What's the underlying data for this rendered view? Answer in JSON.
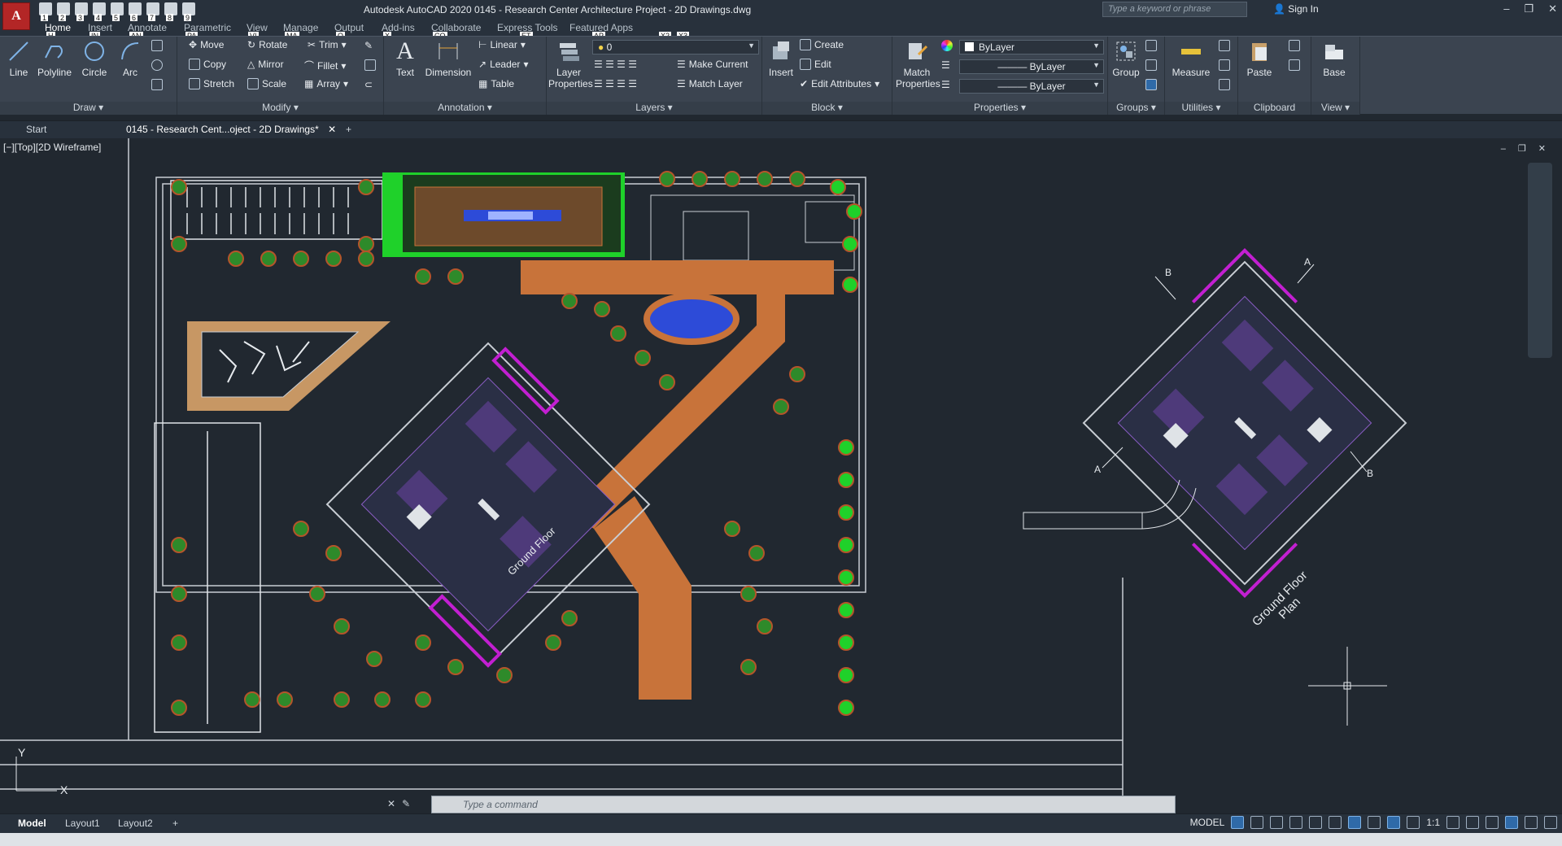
{
  "app": {
    "logo": "A",
    "title": "Autodesk AutoCAD 2020    0145 - Research Center  Architecture Project - 2D Drawings.dwg"
  },
  "search": {
    "placeholder": "Type a keyword or phrase"
  },
  "account": {
    "signin": "Sign In"
  },
  "qat_keytips": [
    "1",
    "2",
    "3",
    "4",
    "5",
    "6",
    "7",
    "8",
    "9"
  ],
  "ribbon_tabs": [
    {
      "label": "Home",
      "key": "H"
    },
    {
      "label": "Insert",
      "key": "IN"
    },
    {
      "label": "Annotate",
      "key": "AN"
    },
    {
      "label": "Parametric",
      "key": "PA"
    },
    {
      "label": "View",
      "key": "VI"
    },
    {
      "label": "Manage",
      "key": "MA"
    },
    {
      "label": "Output",
      "key": "O"
    },
    {
      "label": "Add-ins",
      "key": "X"
    },
    {
      "label": "Collaborate",
      "key": "CO"
    },
    {
      "label": "Express Tools",
      "key": "ET"
    },
    {
      "label": "Featured Apps",
      "key": "AP"
    },
    {
      "label": "",
      "key": "X2"
    },
    {
      "label": "",
      "key": "X3"
    }
  ],
  "panels": {
    "draw": {
      "title": "Draw",
      "line": "Line",
      "polyline": "Polyline",
      "circle": "Circle",
      "arc": "Arc"
    },
    "modify": {
      "title": "Modify",
      "move": "Move",
      "rotate": "Rotate",
      "trim": "Trim",
      "copy": "Copy",
      "mirror": "Mirror",
      "fillet": "Fillet",
      "stretch": "Stretch",
      "scale": "Scale",
      "array": "Array"
    },
    "annotation": {
      "title": "Annotation",
      "text": "Text",
      "dimension": "Dimension",
      "linear": "Linear",
      "leader": "Leader",
      "table": "Table"
    },
    "layers": {
      "title": "Layers",
      "layer_props": "Layer Properties",
      "current_layer": "0",
      "make_current": "Make Current",
      "match_layer": "Match Layer"
    },
    "block": {
      "title": "Block",
      "insert": "Insert",
      "create": "Create",
      "edit": "Edit",
      "edit_attributes": "Edit Attributes"
    },
    "properties": {
      "title": "Properties",
      "match": "Match Properties",
      "color": "ByLayer",
      "linetype": "ByLayer",
      "lineweight": "ByLayer"
    },
    "groups": {
      "title": "Groups",
      "group": "Group"
    },
    "utilities": {
      "title": "Utilities",
      "measure": "Measure"
    },
    "clipboard": {
      "title": "Clipboard",
      "paste": "Paste"
    },
    "view": {
      "title": "View",
      "base": "Base"
    }
  },
  "file_tabs": {
    "start": "Start",
    "drawing": "0145 - Research Cent...oject - 2D Drawings*"
  },
  "viewport": {
    "label": "[−][Top][2D Wireframe]"
  },
  "drawing_labels": {
    "plan_title": "Ground Floor Plan",
    "line1": "Ground Floor",
    "line2": "Plan",
    "section_a": "A",
    "section_b": "B"
  },
  "command": {
    "placeholder": "Type a command"
  },
  "status": {
    "layouts": [
      "Model",
      "Layout1",
      "Layout2"
    ],
    "model_label": "MODEL",
    "scale": "1:1"
  },
  "colors": {
    "accent": "#3b8edb",
    "magenta": "#c21fd1",
    "orange": "#c8733a",
    "green": "#1fd12a"
  }
}
